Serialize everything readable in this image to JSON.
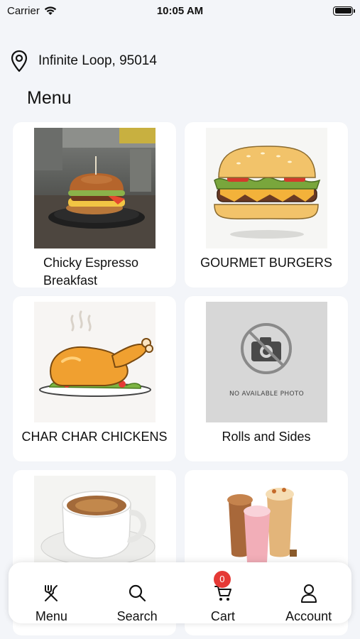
{
  "status_bar": {
    "carrier": "Carrier",
    "time": "10:05 AM"
  },
  "location": {
    "icon": "location-pin-icon",
    "address": "Infinite Loop, 95014"
  },
  "page": {
    "title": "Menu"
  },
  "menu_items": [
    {
      "label": "Chicky Espresso Breakfast",
      "image": "burger-photo"
    },
    {
      "label": "GOURMET BURGERS",
      "image": "burger-illustration"
    },
    {
      "label": "CHAR CHAR CHICKENS",
      "image": "roast-chicken-illustration"
    },
    {
      "label": "Rolls  and Sides",
      "image": "no-photo-placeholder",
      "placeholder_text": "NO AVAILABLE PHOTO"
    },
    {
      "label": "",
      "image": "coffee-cup-photo"
    },
    {
      "label": "",
      "image": "iced-drinks-photo"
    }
  ],
  "bottom_nav": {
    "items": [
      {
        "label": "Menu",
        "icon": "utensils-icon"
      },
      {
        "label": "Search",
        "icon": "search-icon"
      },
      {
        "label": "Cart",
        "icon": "cart-icon",
        "badge": "0"
      },
      {
        "label": "Account",
        "icon": "person-icon"
      }
    ]
  },
  "colors": {
    "background": "#f3f5f9",
    "card": "#ffffff",
    "badge": "#e53935"
  }
}
